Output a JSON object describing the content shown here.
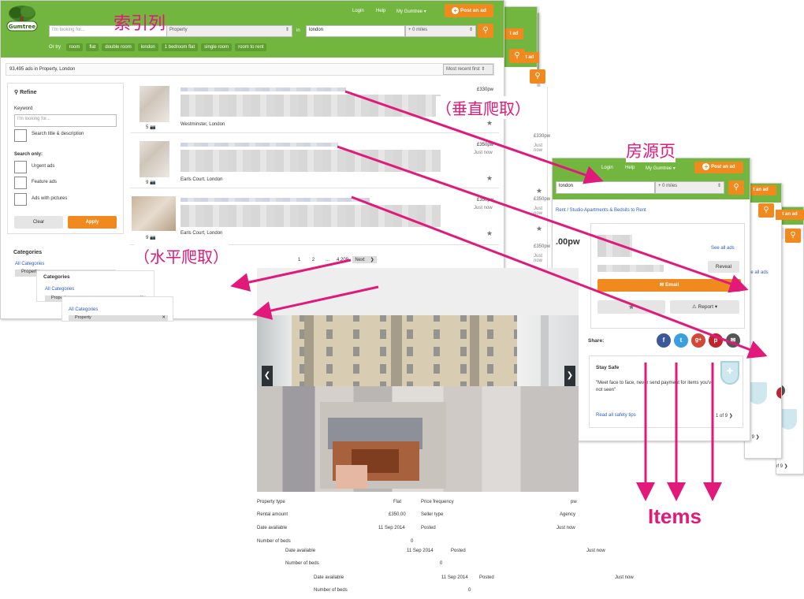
{
  "header": {
    "login": "Login",
    "help": "Help",
    "my_gumtree": "My Gumtree",
    "post_ad": "Post an ad",
    "search_placeholder": "I'm looking for...",
    "category_value": "Property",
    "in_label": "in",
    "location": "london",
    "distance": "+ 0 miles"
  },
  "quick_links": {
    "label": "Or try",
    "items": [
      "room",
      "flat",
      "double room",
      "london",
      "1 bedroom flat",
      "single room",
      "room to rent"
    ]
  },
  "results_count": "93,495 ads in Property, London",
  "sort": "Most recent first",
  "refine": {
    "title": "Refine",
    "keyword_label": "Keyword",
    "keyword_placeholder": "I'm looking for...",
    "search_title": "Search title & description",
    "search_only": "Search only:",
    "urgent": "Urgent ads",
    "feature": "Feature ads",
    "with_pictures": "Ads with pictures",
    "clear": "Clear",
    "apply": "Apply"
  },
  "categories": {
    "title": "Categories",
    "all": "All Categories",
    "property": "Property"
  },
  "listings": [
    {
      "title": "Studio/studio flat studio on Rosebery...",
      "location": "Westminster, London",
      "price": "£330pw",
      "age": "Just now",
      "photos": "5"
    },
    {
      "title": "Studio studio studio on Beaumont Road (male, bills included)",
      "location": "Earls Court, London",
      "price": "£350pw",
      "age": "Just now",
      "photos": "9"
    },
    {
      "title": "Double flat studio studio...",
      "location": "Earls Court, London",
      "price": "£350pw",
      "age": "Just now",
      "photos": "9"
    }
  ],
  "stack_prices": [
    "£330pw",
    "Just now",
    "£350pw",
    "Just now",
    "£350pw",
    "Just now"
  ],
  "pagination": {
    "pages": [
      "1",
      "2",
      "3",
      "4",
      "5",
      "...",
      "4,209"
    ],
    "next": "Next"
  },
  "detail": {
    "breadcrumb": "Rent / Studio Apartments & Bedsits to Rent",
    "price_fragment": ".00pw",
    "see_all": "See all ads",
    "reveal": "Reveal",
    "email": "Email",
    "report": "Report",
    "share": "Share:",
    "stay_safe_title": "Stay Safe",
    "stay_safe_text": "\"Meet face to face, never send payment for items you've not seen\"",
    "safety_link": "Read all safety tips",
    "slide_counter": "1 of 9",
    "props": [
      {
        "label": "Property type",
        "value": "Flat",
        "label2": "Price frequency",
        "value2": "pw"
      },
      {
        "label": "Rental amount",
        "value": "£350.00",
        "label2": "Seller type",
        "value2": "Agency"
      },
      {
        "label": "Date available",
        "value": "11 Sep 2014",
        "label2": "Posted",
        "value2": "Just now"
      },
      {
        "label": "Number of beds",
        "value": "0",
        "label2": "",
        "value2": ""
      }
    ],
    "props2": [
      {
        "label": "Date available",
        "value": "11 Sep 2014",
        "label2": "Posted",
        "value2": "Just now"
      },
      {
        "label": "Number of beds",
        "value": "0",
        "label2": "",
        "value2": ""
      }
    ],
    "stack_see_all": "See all ads"
  },
  "annotations": {
    "index_list": "索引列",
    "vertical": "（垂直爬取）",
    "listing_page": "房源页",
    "horizontal": "（水平爬取）",
    "items": "Items"
  },
  "colors": {
    "brand_green": "#72b63f",
    "accent_orange": "#f08a1e",
    "arrow_pink": "#e0197a"
  }
}
